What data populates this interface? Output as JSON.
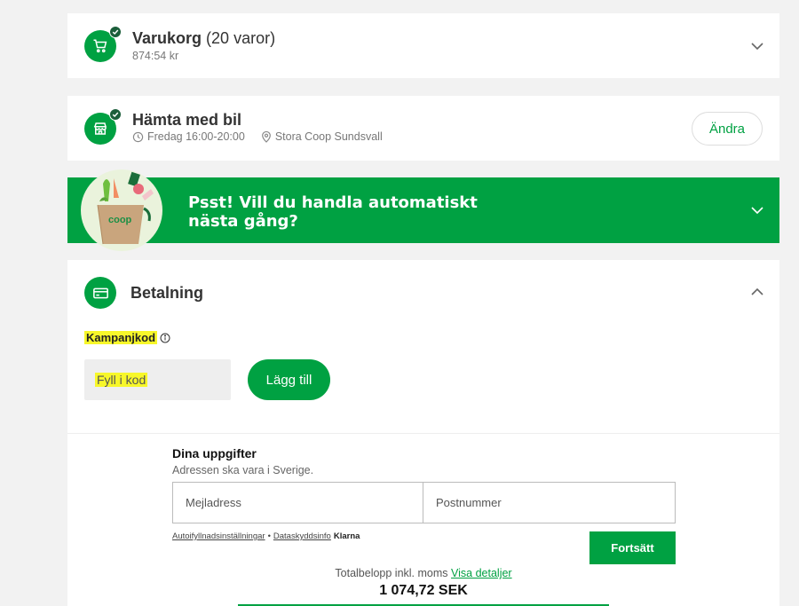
{
  "cart": {
    "title": "Varukorg",
    "count": "(20 varor)",
    "subtotal": "874:54 kr",
    "icon": "cart-icon"
  },
  "pickup": {
    "title": "Hämta med bil",
    "time": "Fredag 16:00-20:00",
    "store": "Stora Coop Sundsvall",
    "change_label": "Ändra",
    "icon": "store-icon"
  },
  "promo": {
    "line1": "Psst! Vill du handla automatiskt",
    "line2": "nästa gång?",
    "bag_label": "coop"
  },
  "payment": {
    "title": "Betalning",
    "icon": "card-icon",
    "campaign_label": "Kampanjkod",
    "campaign_placeholder": "Fyll i kod",
    "add_label": "Lägg till",
    "details_title": "Dina uppgifter",
    "details_subtitle": "Adressen ska vara i Sverige.",
    "email_placeholder": "Mejladress",
    "postal_placeholder": "Postnummer",
    "autofill_link": "Autoifyllnadsinställningar",
    "separator": "•",
    "privacy_link": "Dataskyddsinfo",
    "klarna": "Klarna",
    "continue_label": "Fortsätt",
    "total_label": "Totalbelopp inkl. moms",
    "details_link": "Visa detaljer",
    "total_amount": "1 074,72 SEK"
  },
  "colors": {
    "brand_green": "#00a142",
    "highlight": "#f7f72a"
  }
}
